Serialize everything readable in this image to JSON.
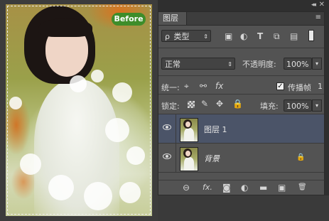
{
  "canvas": {
    "before_label": "Before"
  },
  "panel": {
    "tab_label": "图层",
    "collapse_glyph": "◂◂",
    "close_glyph": "✕",
    "menu_glyph": "≡"
  },
  "filter": {
    "search_glyph": "ρ",
    "kind_label": "类型",
    "filter_icons": [
      "image-filter-icon",
      "adjustment-filter-icon",
      "type-filter-icon",
      "shape-filter-icon",
      "smart-object-filter-icon"
    ]
  },
  "blend": {
    "mode": "正常",
    "opacity_label": "不透明度:",
    "opacity_value": "100%"
  },
  "unify": {
    "label": "统一:",
    "propagate_label": "传播帧",
    "propagate_value": "1",
    "propagate_checked": true
  },
  "lock": {
    "label": "锁定:",
    "fill_label": "填充:",
    "fill_value": "100%"
  },
  "layers": [
    {
      "name": "图层 1",
      "selected": true,
      "visible": true,
      "locked": false
    },
    {
      "name": "背景",
      "selected": false,
      "visible": true,
      "locked": true
    }
  ],
  "toolbar": {
    "link_glyph": "⊖",
    "fx_glyph": "fx.",
    "mask_glyph": "◙",
    "adjust_glyph": "◐",
    "folder_glyph": "▬",
    "new_glyph": "▣",
    "delete_glyph": "🗑"
  },
  "colors": {
    "panel_bg": "#535353",
    "selected_row": "#4b5468",
    "badge_green": "#3e8d2a"
  }
}
